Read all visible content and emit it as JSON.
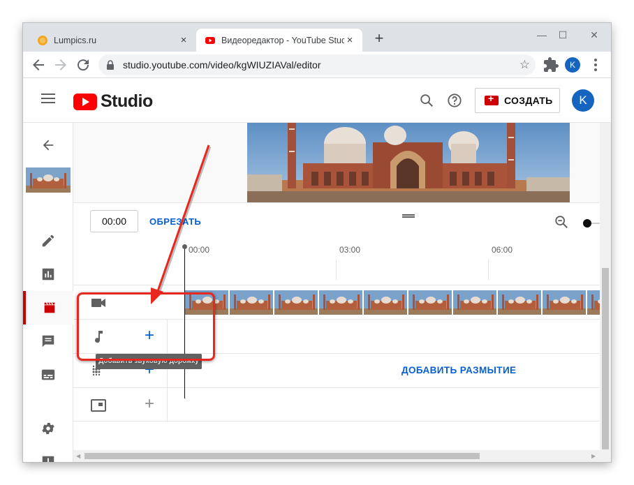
{
  "browser": {
    "tabs": [
      {
        "title": "Lumpics.ru",
        "close": "×"
      },
      {
        "title": "Видеоредактор - YouTube Studio",
        "close": "×"
      }
    ],
    "new_tab": "+",
    "window_controls": {
      "minimize": "—",
      "maximize": "☐",
      "close": "✕"
    },
    "url": "studio.youtube.com/video/kgWIUZIAVal/editor",
    "profile_initial": "K"
  },
  "header": {
    "logo_text": "Studio",
    "create_label": "СОЗДАТЬ",
    "avatar_initial": "K"
  },
  "editor": {
    "time_value": "00:00",
    "trim_label": "ОБРЕЗАТЬ",
    "ruler": [
      "00:00",
      "03:00",
      "06:00"
    ],
    "blur_label": "ДОБАВИТЬ РАЗМЫТИЕ",
    "tooltip": "Добавить звуковую дорожку",
    "add_glyph": "+"
  },
  "colors": {
    "youtube_red": "#ff0000",
    "link_blue": "#065fd4",
    "annotation_red": "#e8281e",
    "avatar_blue": "#1565c0"
  }
}
